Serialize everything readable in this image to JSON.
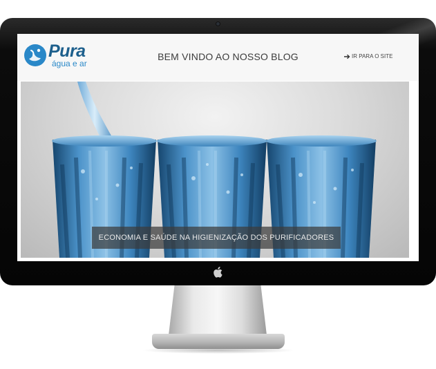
{
  "brand": {
    "name": "Pura",
    "tagline": "água e ar",
    "logo_icon": "water-drop-icon"
  },
  "header": {
    "title": "BEM VINDO AO NOSSO BLOG",
    "site_link_label": "IR PARA O SITE",
    "site_link_icon": "arrow-right-icon"
  },
  "hero": {
    "caption": "ECONOMIA E SAÚDE NA HIGIENIZAÇÃO DOS PURIFICADORES"
  },
  "colors": {
    "brand_primary": "#1d5f8c",
    "brand_secondary": "#2a88c8",
    "water_blue": "#2f78b8"
  }
}
